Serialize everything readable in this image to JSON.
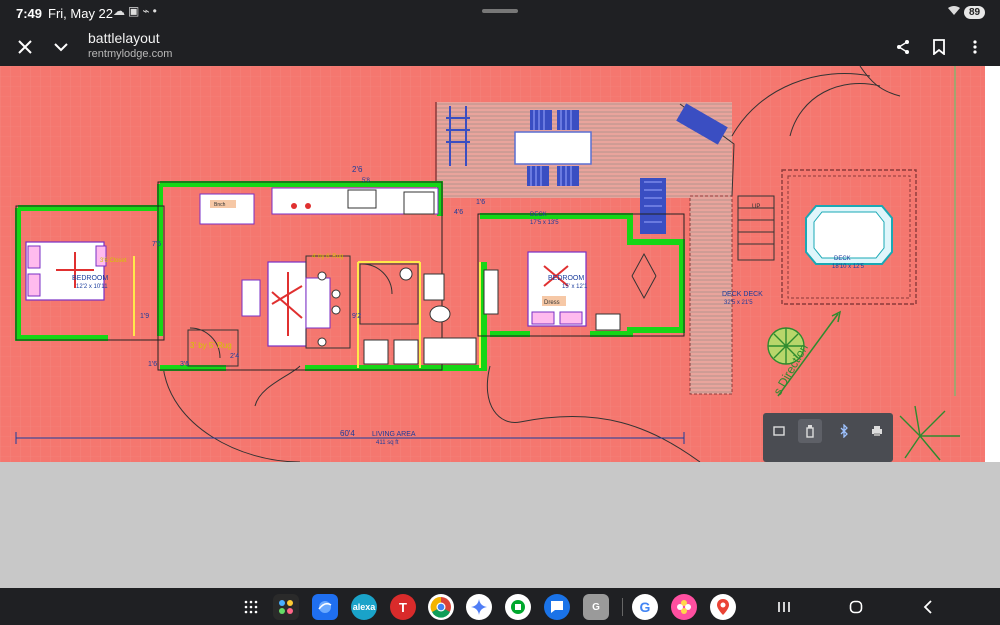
{
  "status_bar": {
    "time": "7:49",
    "date": "Fri, May 22",
    "icons": [
      "cloud-icon",
      "screenshot-icon",
      "no-signal-icon",
      "dot-icon"
    ],
    "battery": "89"
  },
  "app_bar": {
    "title": "battlelayout",
    "subtitle": "rentmylodge.com",
    "actions": [
      "share-icon",
      "bookmark-icon",
      "more-icon"
    ]
  },
  "floor_plan": {
    "labels": {
      "bedroom_left": "BEDROOM",
      "bedroom_left_size": "12'2 x 10'11",
      "closet_left": "3'6 Closet",
      "bedroom_right": "BEDROOM",
      "bedroom_right_size": "15' x 12'1",
      "dresser": "Dress",
      "bench": "Bnch",
      "rug_large": "4' by 6' Rug",
      "rug_small": "3' by 5' Rug",
      "deck_upper": "DECK",
      "deck_upper_size": "18'10 x 12'5",
      "deck_right": "DECK",
      "deck_right_size": "17'5 x 13'5",
      "deck_long": "DECK DECK",
      "deck_long_size": "32'5 x 21'5",
      "wind_direction": "s Direction",
      "living_area": "LIVING AREA",
      "living_area_size": "411 sq ft",
      "dim_total": "60'4",
      "dim_kitchen": "2'6",
      "dim_kitchen_b": "5'8",
      "dim_hall": "7'5",
      "dim_hall_b": "1'9",
      "dim_door": "2'4",
      "dim_stair": "1'6",
      "dim_closet": "9'2",
      "dim_left": "3'6",
      "dim_shower": "1'6",
      "dim_upper": "4'6",
      "dim_right_deck": "UP"
    }
  },
  "popup_icons": [
    "tablet-icon",
    "usb-stick-icon",
    "bluetooth-icon",
    "printer-icon"
  ],
  "dock": {
    "apps": [
      {
        "name": "app-drawer-icon",
        "color": "#1f2023"
      },
      {
        "name": "app-folder-icon",
        "color": "#2a2a2a"
      },
      {
        "name": "samsung-internet-icon",
        "color": "#1f6ff0"
      },
      {
        "name": "alexa-icon",
        "color": "#1aa3c9",
        "label": "alexa"
      },
      {
        "name": "tesla-icon",
        "color": "#d92b2b",
        "label": "T"
      },
      {
        "name": "chrome-icon",
        "color": "#ffffff"
      },
      {
        "name": "gemini-icon",
        "color": "#ffffff"
      },
      {
        "name": "evernote-icon",
        "color": "#ffffff"
      },
      {
        "name": "messages-icon",
        "color": "#1a73e8"
      },
      {
        "name": "recent-app-icon",
        "color": "#9a9a9a",
        "label": "G"
      },
      {
        "name": "google-icon",
        "color": "#ffffff",
        "label": "G"
      },
      {
        "name": "photos-icon",
        "color": "#ff4fa0"
      },
      {
        "name": "maps-icon",
        "color": "#ffffff"
      }
    ]
  },
  "nav": [
    "recents-icon",
    "home-icon",
    "back-icon"
  ]
}
